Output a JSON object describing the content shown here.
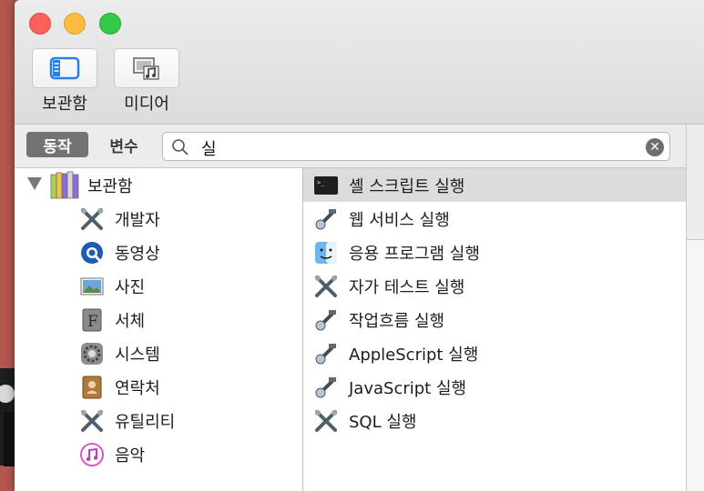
{
  "toolbar": {
    "library_label": "보관함",
    "media_label": "미디어"
  },
  "filter": {
    "actions_label": "동작",
    "variables_label": "변수"
  },
  "search": {
    "query": "실"
  },
  "library": {
    "header_label": "보관함",
    "items": [
      {
        "label": "개발자",
        "icon": "tools-icon"
      },
      {
        "label": "동영상",
        "icon": "quicktime-icon"
      },
      {
        "label": "사진",
        "icon": "photo-icon"
      },
      {
        "label": "서체",
        "icon": "font-icon"
      },
      {
        "label": "시스템",
        "icon": "system-icon"
      },
      {
        "label": "연락처",
        "icon": "contacts-icon"
      },
      {
        "label": "유틸리티",
        "icon": "tools-icon"
      },
      {
        "label": "음악",
        "icon": "music-icon"
      }
    ]
  },
  "actions": {
    "items": [
      {
        "label": "셸 스크립트 실행",
        "icon": "terminal-icon",
        "selected": true
      },
      {
        "label": "웹 서비스 실행",
        "icon": "automator-icon"
      },
      {
        "label": "응용 프로그램 실행",
        "icon": "finder-icon"
      },
      {
        "label": "자가 테스트 실행",
        "icon": "tools-icon"
      },
      {
        "label": "작업흐름 실행",
        "icon": "automator-icon"
      },
      {
        "label": "AppleScript 실행",
        "icon": "automator-icon"
      },
      {
        "label": "JavaScript 실행",
        "icon": "automator-icon"
      },
      {
        "label": "SQL 실행",
        "icon": "tools-icon"
      }
    ]
  },
  "colors": {
    "desktop": "#b3574e",
    "selected_row": "#dcdcdc",
    "segment_active": "#737373"
  }
}
